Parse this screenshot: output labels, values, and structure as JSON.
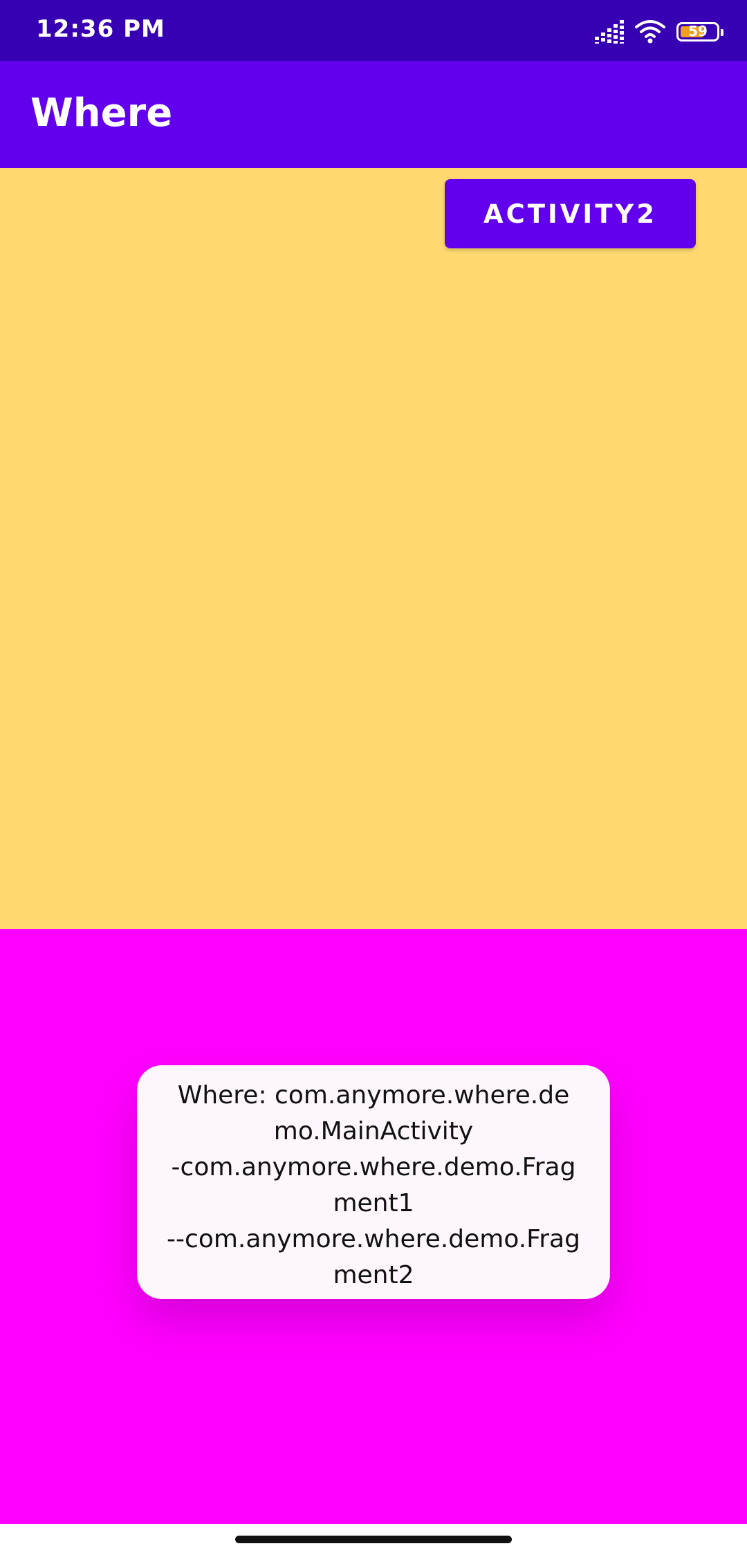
{
  "status_bar": {
    "time": "12:36 PM",
    "battery_level": "59",
    "icons": [
      "signal-icon",
      "wifi-icon",
      "battery-icon"
    ]
  },
  "app_bar": {
    "title": "Where"
  },
  "fragment1": {
    "button_label": "ACTIVITY2",
    "background": "#ffd96f"
  },
  "fragment2": {
    "background": "#ff00ff"
  },
  "toast": {
    "text": "Where: com.anymore.where.demo.MainActivity\n-com.anymore.where.demo.Fragment1\n--com.anymore.where.demo.Fragment2"
  },
  "colors": {
    "status_bar": "#3700b3",
    "primary": "#6200ee",
    "fragment1_bg": "#ffd96f",
    "fragment2_bg": "#ff00ff",
    "toast_bg": "#fdf6fd"
  }
}
